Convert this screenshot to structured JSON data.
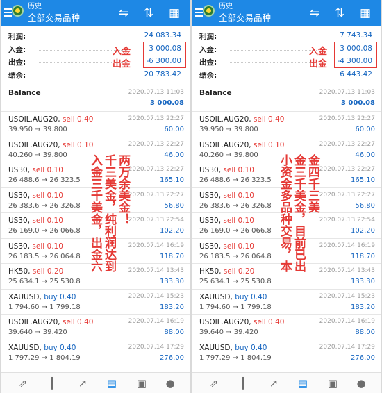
{
  "panels": [
    {
      "header": {
        "subtitle": "历史",
        "title": "全部交易品种"
      },
      "summary": [
        {
          "label": "利润:",
          "value": "24 083.34"
        },
        {
          "label": "入金:",
          "value": "3 000.08"
        },
        {
          "label": "出金:",
          "value": "-6 300.00"
        },
        {
          "label": "结余:",
          "value": "20 783.42"
        }
      ],
      "annotation_small": [
        "入金",
        "出金"
      ],
      "annotation_vertical": [
        "两万余美金！",
        "千三美金，纯利润达到",
        "入金三千美金，出金六"
      ],
      "deals": [
        {
          "symbol": "Balance",
          "action": "",
          "price": "",
          "date": "2020.07.13 11:03",
          "value": "3 000.08"
        },
        {
          "symbol": "USOIL.AUG20,",
          "action": "sell 0.40",
          "price": "39.950 → 39.800",
          "date": "2020.07.13 22:27",
          "value": "60.00"
        },
        {
          "symbol": "USOIL.AUG20,",
          "action": "sell 0.10",
          "price": "40.260 → 39.800",
          "date": "2020.07.13 22:27",
          "value": "46.00"
        },
        {
          "symbol": "US30,",
          "action": "sell 0.10",
          "price": "26 488.6 → 26 323.5",
          "date": "2020.07.13 22:27",
          "value": "165.10"
        },
        {
          "symbol": "US30,",
          "action": "sell 0.10",
          "price": "26 383.6 → 26 326.8",
          "date": "2020.07.13 22:27",
          "value": "56.80"
        },
        {
          "symbol": "US30,",
          "action": "sell 0.10",
          "price": "26 169.0 → 26 066.8",
          "date": "2020.07.13 22:54",
          "value": "102.20"
        },
        {
          "symbol": "US30,",
          "action": "sell 0.10",
          "price": "26 183.5 → 26 064.8",
          "date": "2020.07.14 16:19",
          "value": "118.70"
        },
        {
          "symbol": "HK50,",
          "action": "sell 0.20",
          "price": "25 634.1 → 25 530.8",
          "date": "2020.07.14 13:43",
          "value": "133.30"
        },
        {
          "symbol": "XAUUSD,",
          "action": "buy 0.40",
          "price": "1 794.60 → 1 799.18",
          "date": "2020.07.14 15:23",
          "value": "183.20"
        },
        {
          "symbol": "USOIL.AUG20,",
          "action": "sell 0.40",
          "price": "39.640 → 39.420",
          "date": "2020.07.14 16:19",
          "value": "88.00"
        },
        {
          "symbol": "XAUUSD,",
          "action": "buy 0.40",
          "price": "1 797.29 → 1 804.19",
          "date": "2020.07.14 17:29",
          "value": "276.00"
        }
      ]
    },
    {
      "header": {
        "subtitle": "历史",
        "title": "全部交易品种"
      },
      "summary": [
        {
          "label": "利润:",
          "value": "7 743.34"
        },
        {
          "label": "入金:",
          "value": "3 000.08"
        },
        {
          "label": "出金:",
          "value": "-4 300.00"
        },
        {
          "label": "结余:",
          "value": "6 443.42"
        }
      ],
      "annotation_small": [
        "入金",
        "出金"
      ],
      "annotation_vertical": [
        "金四千三美",
        "金三千美金，目前已出",
        "小资金多品种交易，本"
      ],
      "deals": [
        {
          "symbol": "Balance",
          "action": "",
          "price": "",
          "date": "2020.07.13 11:03",
          "value": "3 000.08"
        },
        {
          "symbol": "USOIL.AUG20,",
          "action": "sell 0.40",
          "price": "39.950 → 39.800",
          "date": "2020.07.13 22:27",
          "value": "60.00"
        },
        {
          "symbol": "USOIL.AUG20,",
          "action": "sell 0.10",
          "price": "40.260 → 39.800",
          "date": "2020.07.13 22:27",
          "value": "46.00"
        },
        {
          "symbol": "US30,",
          "action": "sell 0.10",
          "price": "26 488.6 → 26 323.5",
          "date": "2020.07.13 22:27",
          "value": "165.10"
        },
        {
          "symbol": "US30,",
          "action": "sell 0.10",
          "price": "26 383.6 → 26 326.8",
          "date": "2020.07.13 22:27",
          "value": "56.80"
        },
        {
          "symbol": "US30,",
          "action": "sell 0.10",
          "price": "26 169.0 → 26 066.8",
          "date": "2020.07.13 22:54",
          "value": "102.20"
        },
        {
          "symbol": "US30,",
          "action": "sell 0.10",
          "price": "26 183.5 → 26 064.8",
          "date": "2020.07.14 16:19",
          "value": "118.70"
        },
        {
          "symbol": "HK50,",
          "action": "sell 0.20",
          "price": "25 634.1 → 25 530.8",
          "date": "2020.07.14 13:43",
          "value": "133.30"
        },
        {
          "symbol": "XAUUSD,",
          "action": "buy 0.40",
          "price": "1 794.60 → 1 799.18",
          "date": "2020.07.14 15:23",
          "value": "183.20"
        },
        {
          "symbol": "USOIL.AUG20,",
          "action": "sell 0.40",
          "price": "39.640 → 39.420",
          "date": "2020.07.14 16:19",
          "value": "88.00"
        },
        {
          "symbol": "XAUUSD,",
          "action": "buy 0.40",
          "price": "1 797.29 → 1 804.19",
          "date": "2020.07.14 17:29",
          "value": "276.00"
        }
      ]
    }
  ],
  "toolbar_icons": [
    "sort-icon",
    "updown-icon",
    "calendar-icon"
  ],
  "bottom_icons": [
    "quotes-icon",
    "chart-icon",
    "trade-icon",
    "history-icon",
    "news-icon",
    "messages-icon"
  ],
  "colors": {
    "header": "#1e88e5",
    "accent": "#1565c0",
    "sell": "#e53935",
    "note": "#e53935"
  }
}
